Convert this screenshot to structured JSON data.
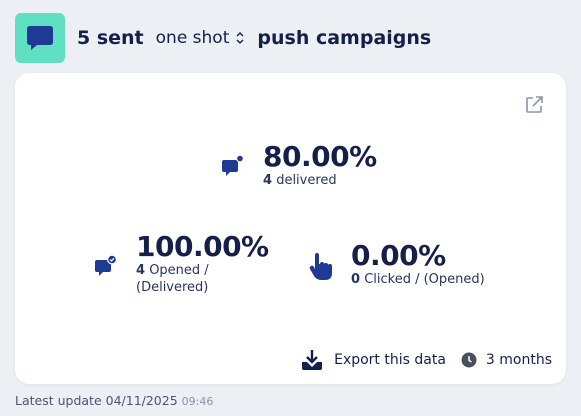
{
  "header": {
    "sent_count": "5 sent",
    "campaign_type": "one shot",
    "title": "push campaigns"
  },
  "stats": {
    "delivery": {
      "percent": "80.00%",
      "count": "4",
      "label": "delivered"
    },
    "opened": {
      "percent": "100.00%",
      "count": "4",
      "label_line1": "Opened /",
      "label_line2": "(Delivered)"
    },
    "clicked": {
      "percent": "0.00%",
      "count": "0",
      "label": "Clicked / (Opened)"
    }
  },
  "footer": {
    "export_label": "Export this data",
    "period_label": "3 months"
  },
  "last_update": {
    "label": "Latest update 04/11/2025",
    "time": "09:46"
  },
  "colors": {
    "accent_tile": "#5fe0c2",
    "brand_navy": "#1f3a93",
    "text_dark": "#15204a"
  },
  "icons": {
    "tile": "chat-bubble-icon",
    "select": "chevron-up-down-icon",
    "external": "open-external-icon",
    "delivered": "message-notification-icon",
    "opened": "message-check-icon",
    "clicked": "pointer-hand-icon",
    "export": "download-icon",
    "period": "clock-icon"
  }
}
